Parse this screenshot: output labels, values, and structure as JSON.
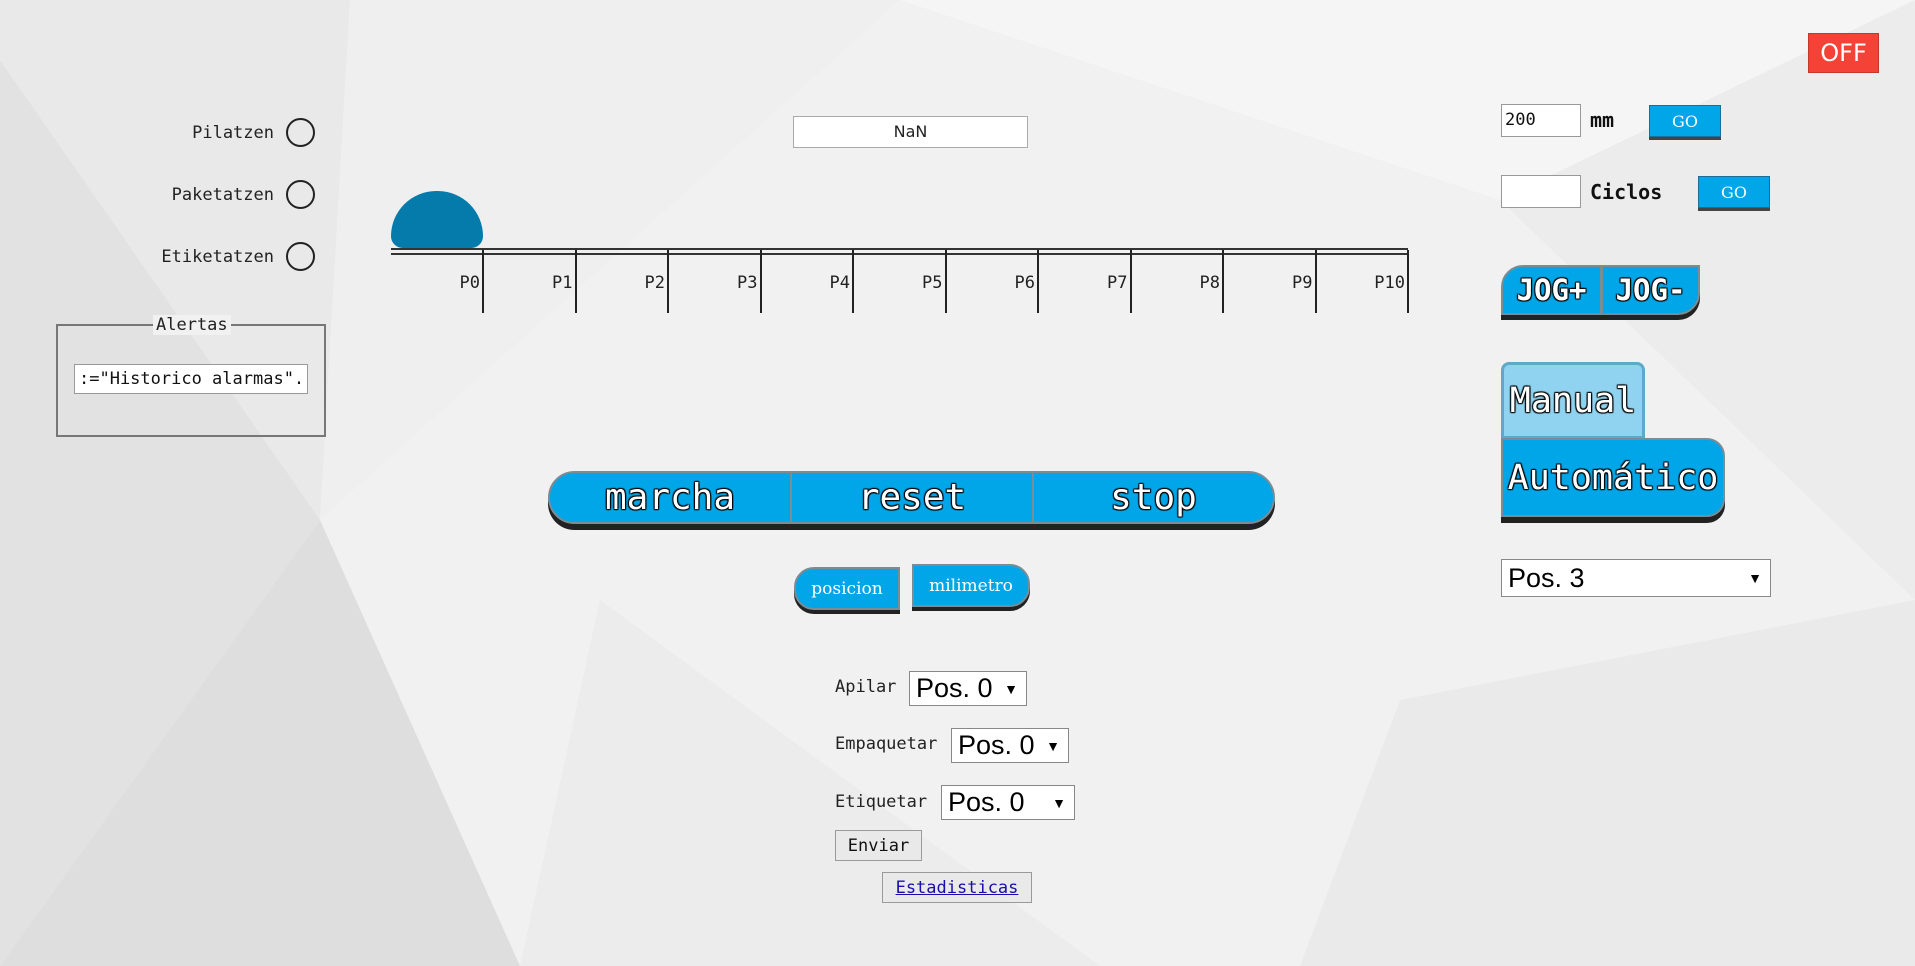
{
  "header": {
    "power_label": "OFF",
    "power_color": "#f44336"
  },
  "status_lights": [
    {
      "label": "Pilatzen"
    },
    {
      "label": "Paketatzen"
    },
    {
      "label": "Etiketatzen"
    }
  ],
  "alerts": {
    "legend": "Alertas",
    "value": ":=\"Historico alarmas\"."
  },
  "track": {
    "value_display": "NaN",
    "positions": [
      "P0",
      "P1",
      "P2",
      "P3",
      "P4",
      "P5",
      "P6",
      "P7",
      "P8",
      "P9",
      "P10"
    ],
    "carriage_position": "P0"
  },
  "controls": {
    "start_label": "marcha",
    "reset_label": "reset",
    "stop_label": "stop"
  },
  "unit_toggle": {
    "position_label": "posicion",
    "millimeter_label": "milimetro"
  },
  "form": {
    "apilar": {
      "label": "Apilar",
      "value": "Pos. 0"
    },
    "empaquetar": {
      "label": "Empaquetar",
      "value": "Pos. 0"
    },
    "etiquetar": {
      "label": "Etiquetar",
      "value": "Pos. 0"
    },
    "submit_label": "Enviar",
    "stats_label": "Estadisticas"
  },
  "right_panel": {
    "mm": {
      "value": "200",
      "unit": "mm",
      "go_label": "GO"
    },
    "cycles": {
      "value": "",
      "unit": "Ciclos",
      "go_label": "GO"
    },
    "jog_plus_label": "JOG+",
    "jog_minus_label": "JOG-",
    "manual_label": "Manual",
    "auto_label": "Automático",
    "position_select": "Pos. 3"
  },
  "colors": {
    "accent": "#00a6e7",
    "carriage": "#047baa",
    "manual_active": "#8fd3f0"
  }
}
